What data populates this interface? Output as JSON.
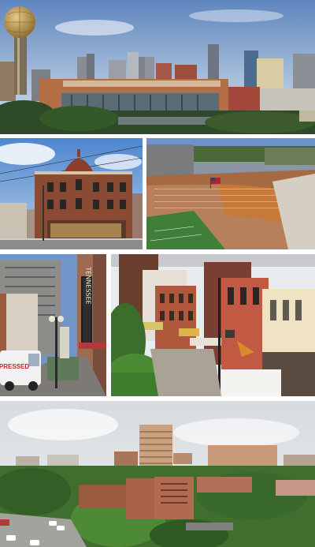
{
  "collage": {
    "panels": [
      {
        "subject": "downtown skyline with sunsphere tower"
      },
      {
        "subject": "historic domed brick corner building"
      },
      {
        "subject": "football stadium crowd"
      },
      {
        "subject": "street with vertical theatre sign"
      },
      {
        "subject": "market square shops with red brick facades"
      },
      {
        "subject": "campus aerial view with tower"
      }
    ]
  },
  "signs": {
    "theatre_sign": "TENNESSEE",
    "van_text": "PRESSED"
  },
  "colors": {
    "sky_blue": "#6f95c9",
    "sphere_gold": "#b8934a",
    "brick_red": "#8a4a34",
    "field_green": "#3f7f3a",
    "stadium_orange": "#c9772f"
  }
}
